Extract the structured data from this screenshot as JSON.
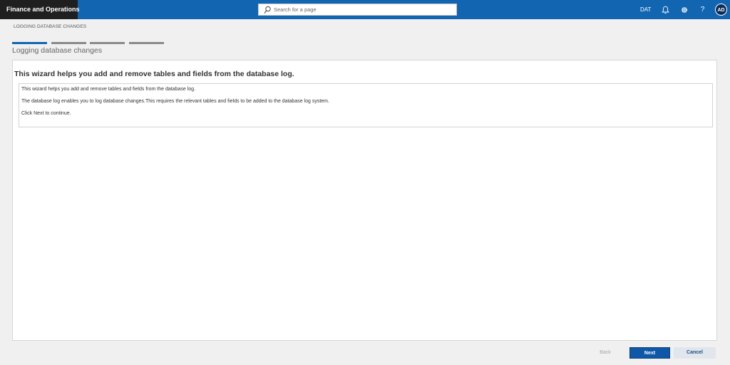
{
  "app": {
    "title": "Finance and Operations",
    "search_placeholder": "Search for a page",
    "company": "DAT",
    "help_glyph": "?",
    "user_initials": "AD",
    "icons": [
      "search-icon",
      "bell-icon",
      "gear-icon",
      "help-icon"
    ],
    "colors": {
      "nav": "#1266b1",
      "brand_bg": "#1f1f1f",
      "avatar": "#0b2c57",
      "primary_button": "#0f58a8"
    }
  },
  "wizard": {
    "breadcrumb": "LOGGING DATABASE CHANGES",
    "title": "Logging database changes",
    "steps_total": 4,
    "current_step": 1,
    "heading": "This wizard helps you add and remove tables and fields from the database log.",
    "body": [
      "This wizard helps you add and remove tables and fields from the database log.",
      "The database log enables you to log database changes.This requires the relevant tables and fields to be added to the database log system.",
      "Click Next to continue."
    ],
    "buttons": {
      "back": "Back",
      "next": "Next",
      "cancel": "Cancel"
    }
  }
}
